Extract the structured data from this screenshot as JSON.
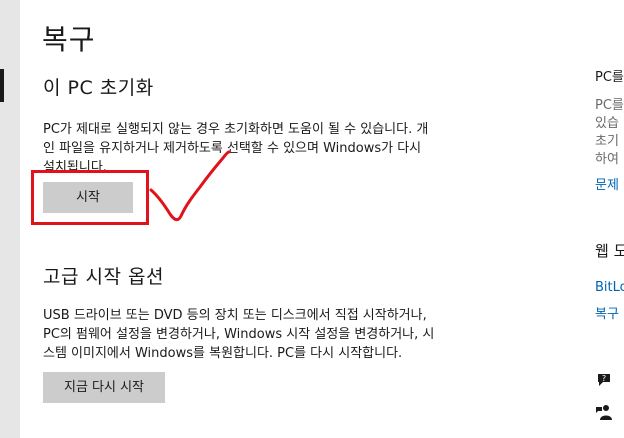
{
  "page": {
    "title": "복구"
  },
  "reset_pc": {
    "heading": "이 PC 초기화",
    "description_lines": [
      "PC가 제대로 실행되지 않는 경우 초기화하면 도움이 될 수 있습니다. 개",
      "인 파일을 유지하거나 제거하도록 선택할 수 있으며 Windows가 다시",
      "설치됩니다."
    ],
    "start_button": "시작"
  },
  "advanced_startup": {
    "heading": "고급 시작 옵션",
    "description_lines": [
      "USB 드라이브 또는 DVD 등의 장치 또는 디스크에서 직접 시작하거나,",
      "PC의 펌웨어 설정을 변경하거나, Windows 시작 설정을 변경하거나, 시",
      "스템 이미지에서 Windows를 복원합니다. PC를 다시 시작합니다."
    ],
    "restart_now_button": "지금 다시 시작"
  },
  "right_panel": {
    "heading1": "PC를",
    "lines": [
      "PC를",
      "있습",
      "초기",
      "하여"
    ],
    "link1": "문제",
    "heading2": "웹 도",
    "link2": "BitLo",
    "link3": "복구"
  },
  "icons": {
    "help": "question-bubble-icon",
    "feedback": "feedback-person-icon"
  },
  "colors": {
    "annotation_red": "#e0131a",
    "link_blue": "#0063b1",
    "button_gray": "#cccccc"
  }
}
